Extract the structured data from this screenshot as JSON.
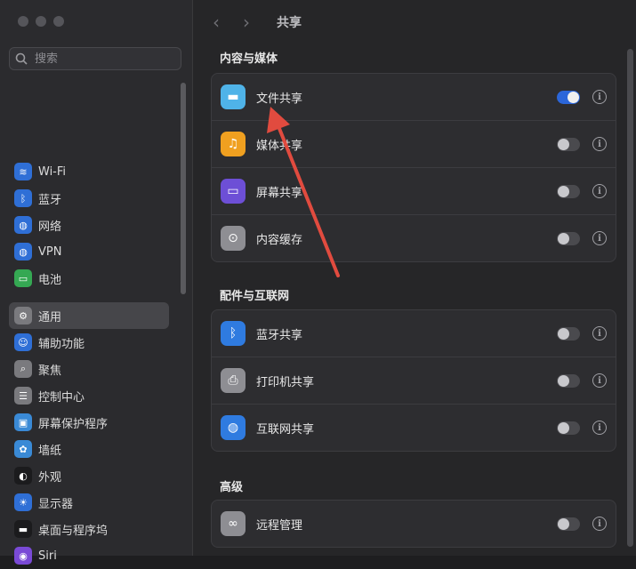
{
  "sidebar": {
    "search_placeholder": "搜索",
    "items": [
      {
        "label": "Wi-Fi",
        "icon": "wifi-icon",
        "color": "#2f6fd6"
      },
      {
        "label": "蓝牙",
        "icon": "bluetooth-icon",
        "color": "#2f6fd6"
      },
      {
        "label": "网络",
        "icon": "globe-icon",
        "color": "#2f6fd6"
      },
      {
        "label": "VPN",
        "icon": "vpn-icon",
        "color": "#2f6fd6"
      },
      {
        "label": "电池",
        "icon": "battery-icon",
        "color": "#35a853"
      },
      {
        "label": "通用",
        "icon": "gear-icon",
        "color": "#7a7a7e"
      },
      {
        "label": "辅助功能",
        "icon": "accessibility-icon",
        "color": "#2f6fd6"
      },
      {
        "label": "聚焦",
        "icon": "magnifier-icon",
        "color": "#7a7a7e"
      },
      {
        "label": "控制中心",
        "icon": "control-center-icon",
        "color": "#7a7a7e"
      },
      {
        "label": "屏幕保护程序",
        "icon": "screensaver-icon",
        "color": "#3a8ad6"
      },
      {
        "label": "墙纸",
        "icon": "wallpaper-icon",
        "color": "#3a8ad6"
      },
      {
        "label": "外观",
        "icon": "appearance-icon",
        "color": "#1b1b1d"
      },
      {
        "label": "显示器",
        "icon": "display-icon",
        "color": "#2f6fd6"
      },
      {
        "label": "桌面与程序坞",
        "icon": "dock-icon",
        "color": "#1b1b1d"
      },
      {
        "label": "Siri",
        "icon": "siri-icon",
        "color": "#7a4ad6"
      }
    ],
    "active_index": 5
  },
  "header": {
    "title": "共享",
    "back": "‹",
    "forward": "›"
  },
  "sections": [
    {
      "title": "内容与媒体",
      "rows": [
        {
          "label": "文件共享",
          "icon": "folder-icon",
          "color": "#4fb3e8",
          "on": true
        },
        {
          "label": "媒体共享",
          "icon": "media-icon",
          "color": "#f0a020",
          "on": false
        },
        {
          "label": "屏幕共享",
          "icon": "screen-share-icon",
          "color": "#6d4fd6",
          "on": false
        },
        {
          "label": "内容缓存",
          "icon": "cache-icon",
          "color": "#8e8e93",
          "on": false
        }
      ]
    },
    {
      "title": "配件与互联网",
      "rows": [
        {
          "label": "蓝牙共享",
          "icon": "bluetooth-icon",
          "color": "#2f7be0",
          "on": false
        },
        {
          "label": "打印机共享",
          "icon": "printer-icon",
          "color": "#8e8e93",
          "on": false
        },
        {
          "label": "互联网共享",
          "icon": "globe-icon",
          "color": "#2f7be0",
          "on": false
        }
      ]
    },
    {
      "title": "高级",
      "rows": [
        {
          "label": "远程管理",
          "icon": "binoculars-icon",
          "color": "#8e8e93",
          "on": false
        }
      ]
    }
  ],
  "info_glyph": "i",
  "accent_color": "#2b66d9",
  "annotation_arrow_color": "#e14b3f"
}
